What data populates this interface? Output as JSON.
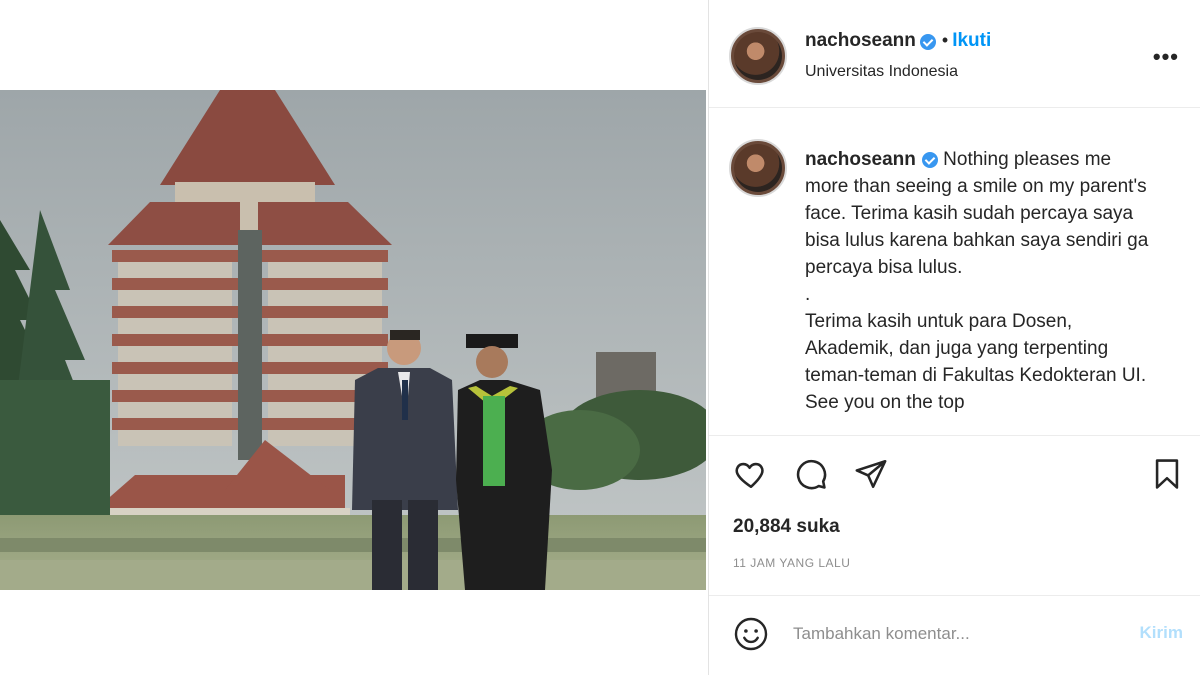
{
  "post": {
    "username": "nachoseann",
    "follow_label": "Ikuti",
    "separator": "•",
    "location": "Universitas Indonesia",
    "more_label": "•••",
    "caption_lines": [
      "Nothing pleases me",
      "more than seeing a smile on my parent's",
      "face. Terima kasih sudah percaya saya",
      "bisa lulus karena bahkan saya sendiri ga",
      "percaya bisa lulus.",
      ".",
      "Terima kasih untuk para Dosen,",
      "Akademik, dan juga yang terpenting",
      "teman-teman di Fakultas Kedokteran UI.",
      "See you on the top"
    ],
    "likes": "20,884 suka",
    "time_ago": "11 JAM YANG LALU"
  },
  "comment": {
    "placeholder": "Tambahkan komentar...",
    "post_label": "Kirim"
  },
  "icons": {
    "like": "heart-icon",
    "comment": "comment-icon",
    "share": "send-icon",
    "save": "bookmark-icon",
    "emoji": "emoji-icon",
    "verified": "verified-badge-icon"
  },
  "colors": {
    "accent": "#0095f6",
    "verified": "#3897f0",
    "post_disabled": "#b2dffc",
    "muted": "#8e8e8e"
  }
}
